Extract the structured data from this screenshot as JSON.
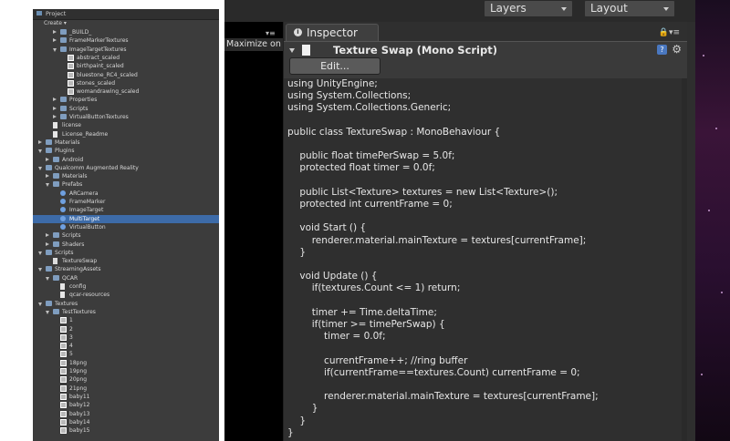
{
  "project_panel": {
    "tab_label": "Project",
    "create_label": "Create ▾",
    "rows": [
      {
        "label": "_BUILD_",
        "depth": 2,
        "type": "folder",
        "tri": "closed"
      },
      {
        "label": "FrameMarkerTextures",
        "depth": 2,
        "type": "folder",
        "tri": "closed"
      },
      {
        "label": "ImageTargetTextures",
        "depth": 2,
        "type": "folder",
        "tri": "open"
      },
      {
        "label": "abstract_scaled",
        "depth": 3,
        "type": "tex",
        "tri": ""
      },
      {
        "label": "birthpaint_scaled",
        "depth": 3,
        "type": "tex",
        "tri": ""
      },
      {
        "label": "bluestone_RC4_scaled",
        "depth": 3,
        "type": "tex",
        "tri": ""
      },
      {
        "label": "stones_scaled",
        "depth": 3,
        "type": "tex",
        "tri": ""
      },
      {
        "label": "womandrawing_scaled",
        "depth": 3,
        "type": "tex",
        "tri": ""
      },
      {
        "label": "Properties",
        "depth": 2,
        "type": "folder",
        "tri": "closed"
      },
      {
        "label": "Scripts",
        "depth": 2,
        "type": "folder",
        "tri": "closed"
      },
      {
        "label": "VirtualButtonTextures",
        "depth": 2,
        "type": "folder",
        "tri": "closed"
      },
      {
        "label": "license",
        "depth": 1,
        "type": "file",
        "tri": ""
      },
      {
        "label": "License_Readme",
        "depth": 1,
        "type": "file",
        "tri": ""
      },
      {
        "label": "Materials",
        "depth": 0,
        "type": "folder",
        "tri": "closed"
      },
      {
        "label": "Plugins",
        "depth": 0,
        "type": "folder",
        "tri": "open"
      },
      {
        "label": "Android",
        "depth": 1,
        "type": "folder",
        "tri": "closed"
      },
      {
        "label": "Qualcomm Augmented Reality",
        "depth": 0,
        "type": "folder",
        "tri": "open"
      },
      {
        "label": "Materials",
        "depth": 1,
        "type": "folder",
        "tri": "closed"
      },
      {
        "label": "Prefabs",
        "depth": 1,
        "type": "folder",
        "tri": "open"
      },
      {
        "label": "ARCamera",
        "depth": 2,
        "type": "prefab",
        "tri": ""
      },
      {
        "label": "FrameMarker",
        "depth": 2,
        "type": "prefab",
        "tri": ""
      },
      {
        "label": "ImageTarget",
        "depth": 2,
        "type": "prefab",
        "tri": ""
      },
      {
        "label": "MultiTarget",
        "depth": 2,
        "type": "prefab",
        "tri": "",
        "selected": true
      },
      {
        "label": "VirtualButton",
        "depth": 2,
        "type": "prefab",
        "tri": ""
      },
      {
        "label": "Scripts",
        "depth": 1,
        "type": "folder",
        "tri": "closed"
      },
      {
        "label": "Shaders",
        "depth": 1,
        "type": "folder",
        "tri": "closed"
      },
      {
        "label": "Scripts",
        "depth": 0,
        "type": "folder",
        "tri": "open"
      },
      {
        "label": "TextureSwap",
        "depth": 1,
        "type": "script",
        "tri": ""
      },
      {
        "label": "StreamingAssets",
        "depth": 0,
        "type": "folder",
        "tri": "open"
      },
      {
        "label": "QCAR",
        "depth": 1,
        "type": "folder",
        "tri": "open"
      },
      {
        "label": "config",
        "depth": 2,
        "type": "file",
        "tri": ""
      },
      {
        "label": "qcar-resources",
        "depth": 2,
        "type": "file",
        "tri": ""
      },
      {
        "label": "Textures",
        "depth": 0,
        "type": "folder",
        "tri": "open"
      },
      {
        "label": "TestTextures",
        "depth": 1,
        "type": "folder",
        "tri": "open"
      },
      {
        "label": "1",
        "depth": 2,
        "type": "tex",
        "tri": ""
      },
      {
        "label": "2",
        "depth": 2,
        "type": "tex",
        "tri": ""
      },
      {
        "label": "3",
        "depth": 2,
        "type": "tex",
        "tri": ""
      },
      {
        "label": "4",
        "depth": 2,
        "type": "tex",
        "tri": ""
      },
      {
        "label": "5",
        "depth": 2,
        "type": "tex",
        "tri": ""
      },
      {
        "label": "18png",
        "depth": 2,
        "type": "tex",
        "tri": ""
      },
      {
        "label": "19png",
        "depth": 2,
        "type": "tex",
        "tri": ""
      },
      {
        "label": "20png",
        "depth": 2,
        "type": "tex",
        "tri": ""
      },
      {
        "label": "21png",
        "depth": 2,
        "type": "tex",
        "tri": ""
      },
      {
        "label": "baby11",
        "depth": 2,
        "type": "tex",
        "tri": ""
      },
      {
        "label": "baby12",
        "depth": 2,
        "type": "tex",
        "tri": ""
      },
      {
        "label": "baby13",
        "depth": 2,
        "type": "tex",
        "tri": ""
      },
      {
        "label": "baby14",
        "depth": 2,
        "type": "tex",
        "tri": ""
      },
      {
        "label": "baby15",
        "depth": 2,
        "type": "tex",
        "tri": ""
      }
    ]
  },
  "toolbar": {
    "layers_label": "Layers",
    "layout_label": "Layout"
  },
  "game_view": {
    "maximize_label": "Maximize on"
  },
  "inspector": {
    "tab_label": "Inspector",
    "component_name": "Texture Swap (Mono Script)",
    "edit_button_label": "Edit...",
    "help_icon": "?",
    "code_lines": [
      "using UnityEngine;",
      "using System.Collections;",
      "using System.Collections.Generic;",
      "",
      "public class TextureSwap : MonoBehaviour {",
      "",
      "    public float timePerSwap = 5.0f;",
      "    protected float timer = 0.0f;",
      "",
      "    public List<Texture> textures = new List<Texture>();",
      "    protected int currentFrame = 0;",
      "",
      "    void Start () {",
      "        renderer.material.mainTexture = textures[currentFrame];",
      "    }",
      "",
      "    void Update () {",
      "        if(textures.Count <= 1) return;",
      "",
      "        timer += Time.deltaTime;",
      "        if(timer >= timePerSwap) {",
      "            timer = 0.0f;",
      "",
      "            currentFrame++; //ring buffer",
      "            if(currentFrame==textures.Count) currentFrame = 0;",
      "",
      "            renderer.material.mainTexture = textures[currentFrame];",
      "        }",
      "    }",
      "}"
    ]
  },
  "colors": {
    "selection": "#3d6ba8",
    "panel_bg": "#3c3c3c",
    "inspector_bg": "#2f2f2f"
  }
}
